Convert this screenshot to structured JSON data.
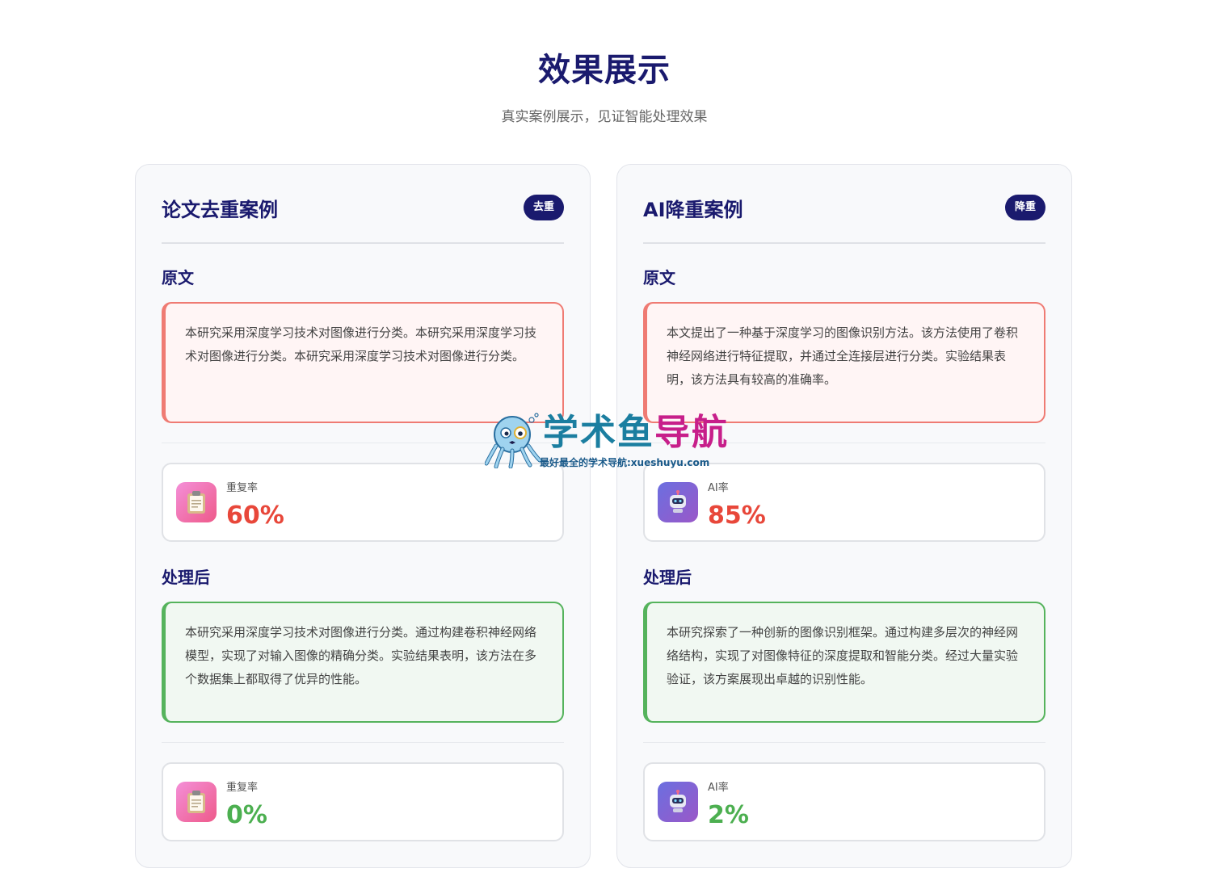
{
  "section": {
    "title": "效果展示",
    "subtitle": "真实案例展示，见证智能处理效果"
  },
  "cards": [
    {
      "title": "论文去重案例",
      "badge": "去重",
      "original_heading": "原文",
      "original_text": "本研究采用深度学习技术对图像进行分类。本研究采用深度学习技术对图像进行分类。本研究采用深度学习技术对图像进行分类。",
      "before_stat": {
        "label": "重复率",
        "value": "60%",
        "icon": "clipboard-icon"
      },
      "processed_heading": "处理后",
      "processed_text": "本研究采用深度学习技术对图像进行分类。通过构建卷积神经网络模型，实现了对输入图像的精确分类。实验结果表明，该方法在多个数据集上都取得了优异的性能。",
      "after_stat": {
        "label": "重复率",
        "value": "0%",
        "icon": "clipboard-icon"
      }
    },
    {
      "title": "AI降重案例",
      "badge": "降重",
      "original_heading": "原文",
      "original_text": "本文提出了一种基于深度学习的图像识别方法。该方法使用了卷积神经网络进行特征提取，并通过全连接层进行分类。实验结果表明，该方法具有较高的准确率。",
      "before_stat": {
        "label": "AI率",
        "value": "85%",
        "icon": "robot-icon"
      },
      "processed_heading": "处理后",
      "processed_text": "本研究探索了一种创新的图像识别框架。通过构建多层次的神经网络结构，实现了对图像特征的深度提取和智能分类。经过大量实验验证，该方案展现出卓越的识别性能。",
      "after_stat": {
        "label": "AI率",
        "value": "2%",
        "icon": "robot-icon"
      }
    }
  ],
  "watermark": {
    "title_part1": "学术鱼",
    "title_part2": "导航",
    "subtitle": "最好最全的学术导航:xueshuyu.com"
  },
  "colors": {
    "primary": "#1a1a6e",
    "bad": "#e8473a",
    "good": "#4caf50",
    "original_border": "#ef7b73",
    "processed_border": "#55b35c"
  }
}
